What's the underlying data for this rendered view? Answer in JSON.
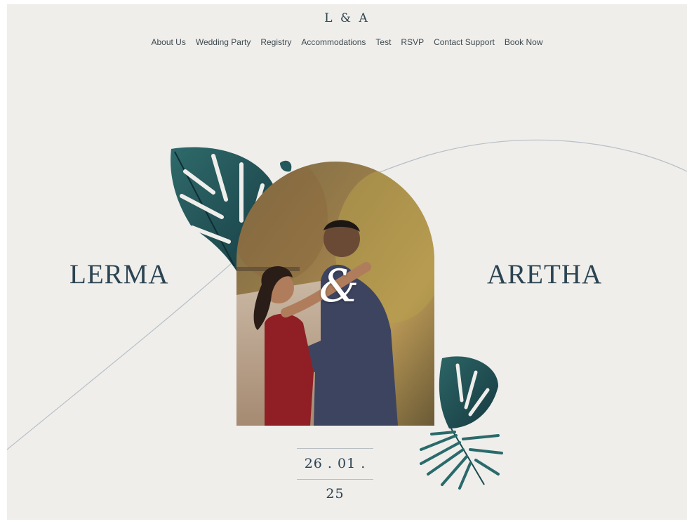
{
  "header": {
    "logo": "L & A",
    "nav": [
      {
        "label": "About Us"
      },
      {
        "label": "Wedding Party"
      },
      {
        "label": "Registry"
      },
      {
        "label": "Accommodations"
      },
      {
        "label": "Test"
      },
      {
        "label": "RSVP"
      },
      {
        "label": "Contact Support"
      },
      {
        "label": "Book Now"
      }
    ]
  },
  "hero": {
    "name_left": "LERMA",
    "ampersand": "&",
    "name_right": "ARETHA",
    "date": "26 . 01 . 25",
    "photo_alt": "couple-photo",
    "decor": [
      "monstera-leaf-icon",
      "palm-leaf-icon"
    ]
  },
  "colors": {
    "background": "#efeeeb",
    "text": "#2c4452",
    "leaf": "#1f4f53",
    "curve": "#b8bfc6"
  }
}
